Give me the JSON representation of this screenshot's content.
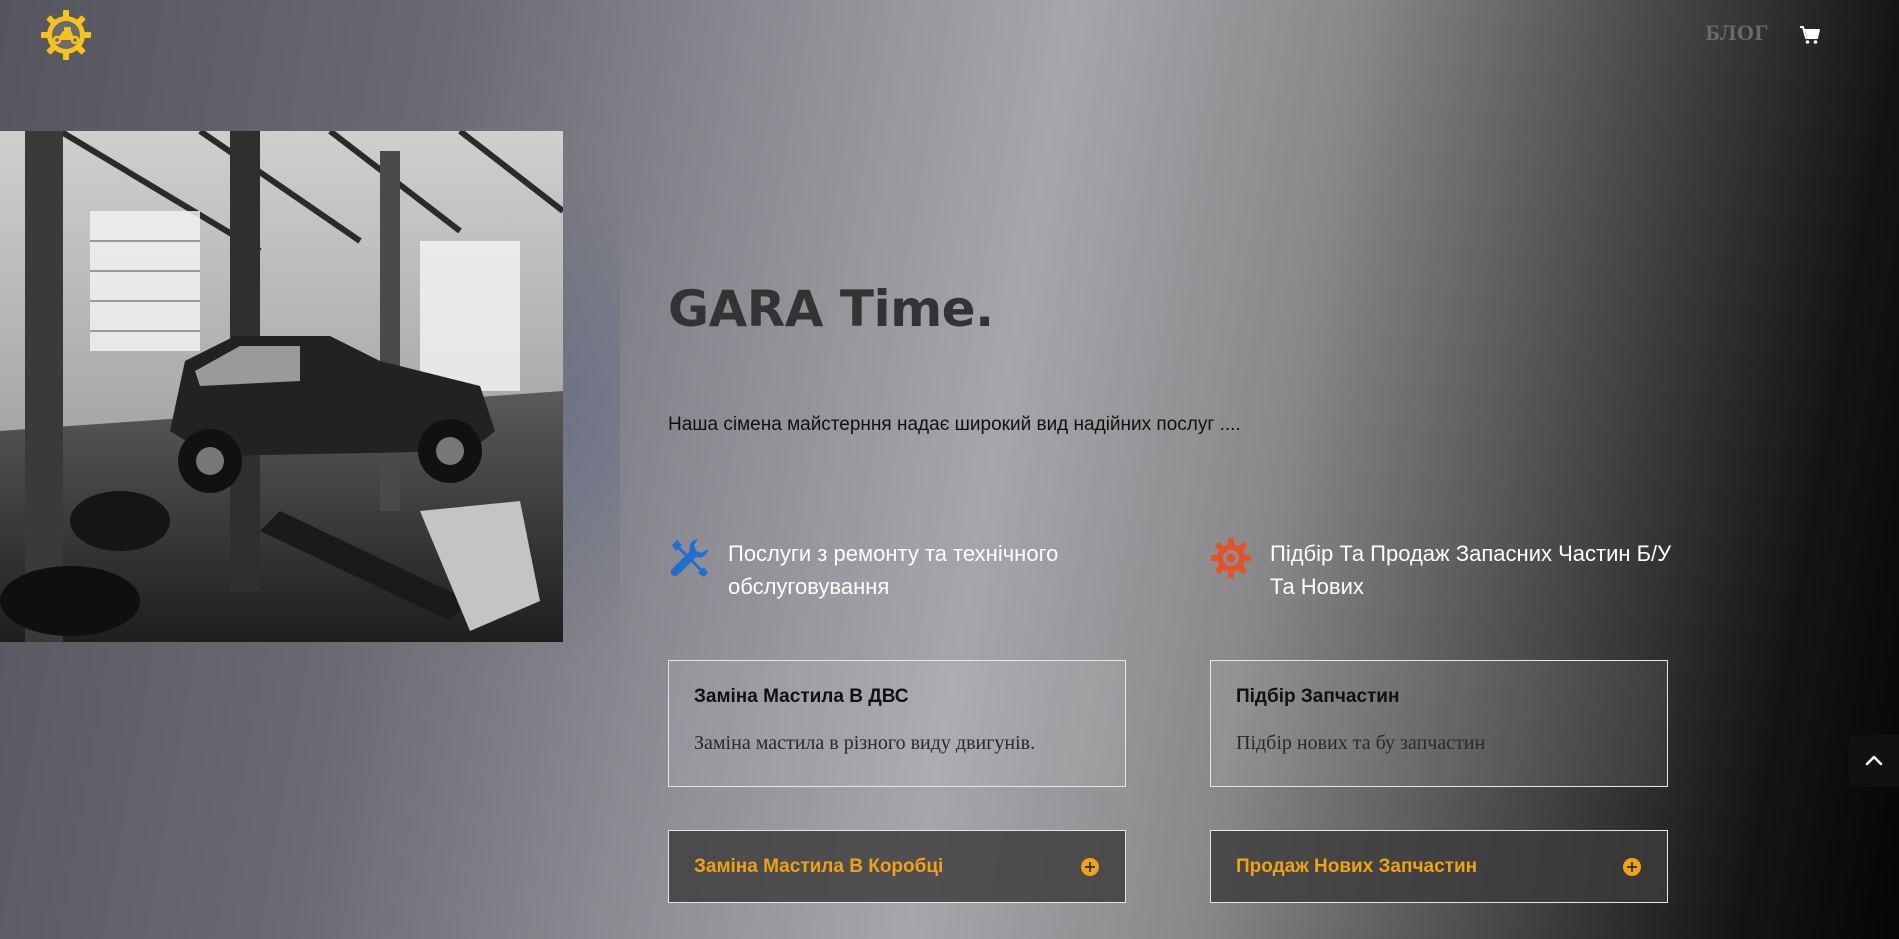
{
  "header": {
    "logo_icon": "gear-motorcycle-logo-icon",
    "nav": [
      {
        "label": "БЛОГ"
      }
    ],
    "cart_icon": "cart-icon"
  },
  "hero": {
    "image": "car-repair-garage-photo",
    "title": "GARA Time.",
    "subtitle": "Наша сімена майстерння надає широкий вид надійних послуг ...."
  },
  "blurbs": [
    {
      "icon": "tools-icon",
      "icon_color": "#1f6fd0",
      "title": "Послуги з ремонту та технічного обслуговування"
    },
    {
      "icon": "gear-icon",
      "icon_color": "#e2532a",
      "title": "Підбір Та Продаж Запасних Частин Б/У Та Нових"
    }
  ],
  "toggles": [
    {
      "title": "Заміна Мастила В ДВС",
      "text": "Заміна мастила в різного виду двигунів.",
      "open": true
    },
    {
      "title": "Підбір Запчастин",
      "text": "Підбір нових та бу запчастин",
      "open": true
    },
    {
      "title": "Заміна Мастила В Коробці",
      "open": false
    },
    {
      "title": "Продаж Нових Запчастин",
      "open": false
    }
  ],
  "colors": {
    "accent": "#f0a215",
    "logo": "#f6c21c"
  },
  "back_to_top_icon": "chevron-up-icon"
}
